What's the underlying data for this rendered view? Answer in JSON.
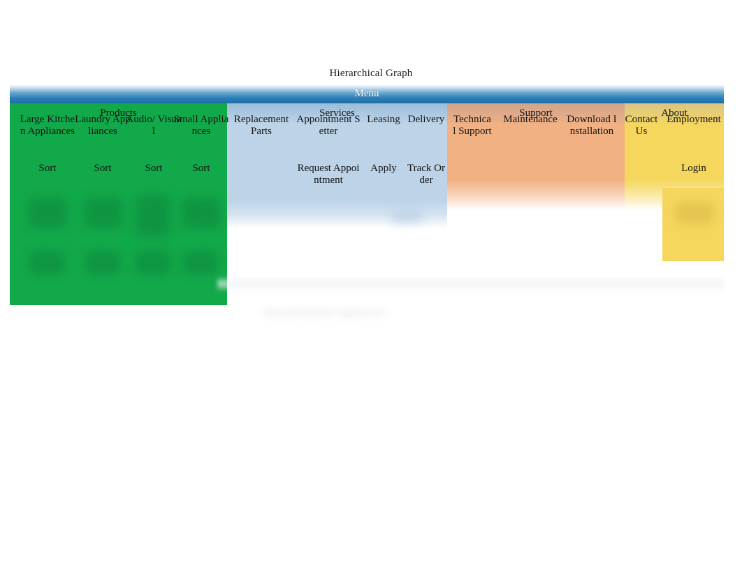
{
  "title": "Hierarchical Graph",
  "root": {
    "label": "Menu"
  },
  "colors": {
    "products": "#12A94A",
    "services": "#BDD3E8",
    "support": "#F2B183",
    "about": "#F5D75E",
    "menu_bar": "#2B7FB8",
    "text": "#141414",
    "menu_bar_text": "#FFFFFF"
  },
  "categories": [
    {
      "label": "Products",
      "color_key": "products",
      "children": [
        {
          "label": "Large Kitchen Appliances",
          "sub": "Sort"
        },
        {
          "label": "Laundry Appliances",
          "sub": "Sort"
        },
        {
          "label": "Audio/ Visual",
          "sub": "Sort"
        },
        {
          "label": "Small Appliances",
          "sub": "Sort"
        }
      ]
    },
    {
      "label": "Services",
      "color_key": "services",
      "children": [
        {
          "label": "Replacement Parts",
          "sub": ""
        },
        {
          "label": "Appointment Setter",
          "sub": "Request Appointment"
        },
        {
          "label": "Leasing",
          "sub": "Apply"
        },
        {
          "label": "Delivery",
          "sub": "Track Order"
        }
      ]
    },
    {
      "label": "Support",
      "color_key": "support",
      "children": [
        {
          "label": "Technical Support",
          "sub": ""
        },
        {
          "label": "Maintenance",
          "sub": ""
        },
        {
          "label": "Download Installation",
          "sub": ""
        }
      ]
    },
    {
      "label": "About",
      "color_key": "about",
      "children": [
        {
          "label": "Contact Us",
          "sub": ""
        },
        {
          "label": "Employment",
          "sub": "Login"
        }
      ]
    }
  ],
  "caption": {
    "text": "obscured blurred caption text",
    "legible": false
  }
}
